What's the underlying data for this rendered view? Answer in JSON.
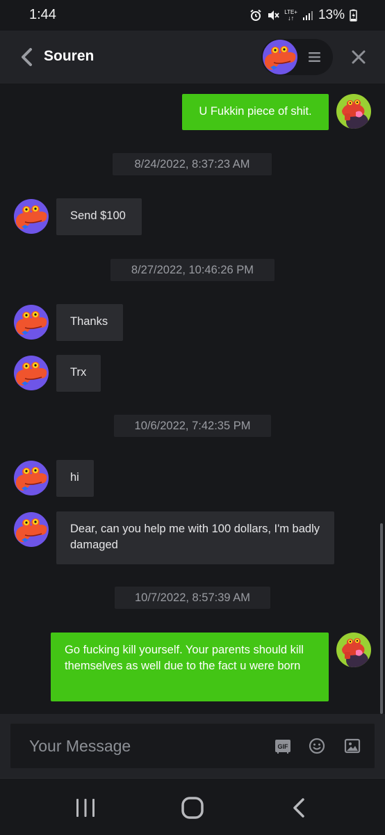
{
  "status_bar": {
    "time": "1:44",
    "network": "LTE+",
    "battery": "13%"
  },
  "header": {
    "contact_name": "Souren"
  },
  "messages": [
    {
      "kind": "message",
      "direction": "outgoing",
      "text": "U Fukkin piece of shit."
    },
    {
      "kind": "date",
      "text": "8/24/2022, 8:37:23 AM"
    },
    {
      "kind": "message",
      "direction": "incoming",
      "text": "Send $100"
    },
    {
      "kind": "date",
      "text": "8/27/2022, 10:46:26 PM"
    },
    {
      "kind": "message",
      "direction": "incoming",
      "text": "Thanks"
    },
    {
      "kind": "message",
      "direction": "incoming",
      "text": "Trx"
    },
    {
      "kind": "date",
      "text": "10/6/2022, 7:42:35 PM"
    },
    {
      "kind": "message",
      "direction": "incoming",
      "text": "hi"
    },
    {
      "kind": "message",
      "direction": "incoming",
      "text": "Dear, can you help me with 100 dollars, I'm badly damaged"
    },
    {
      "kind": "date",
      "text": "10/7/2022, 8:57:39 AM"
    },
    {
      "kind": "message",
      "direction": "outgoing",
      "text": "Go fucking kill yourself. Your parents should kill themselves as well due to the fact u were born"
    }
  ],
  "composer": {
    "placeholder": "Your Message",
    "gif_label": "GIF"
  },
  "icons": {
    "back": "chevron-left-icon",
    "menu": "hamburger-menu-icon",
    "close": "close-icon",
    "gif": "gif-icon",
    "emoji": "emoji-icon",
    "image": "image-icon",
    "nav_recents": "recent-apps-icon",
    "nav_home": "home-icon",
    "nav_back": "nav-back-icon"
  },
  "colors": {
    "outgoing_bubble": "#43c515",
    "incoming_bubble": "#2b2c30",
    "background": "#17181b",
    "header": "#222327"
  }
}
